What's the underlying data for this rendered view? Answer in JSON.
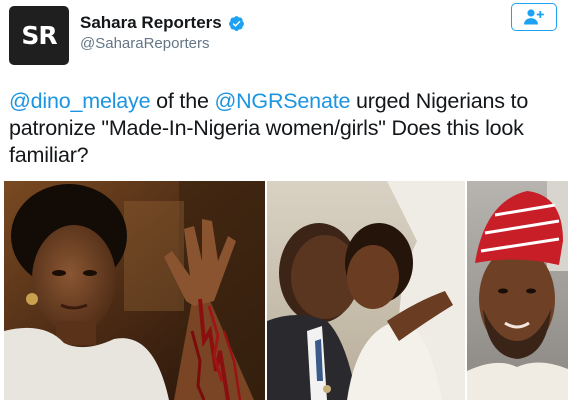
{
  "account": {
    "avatar_text": "SR",
    "display_name": "Sahara Reporters",
    "screen_name": "@SaharaReporters",
    "verified": true
  },
  "follow_button": {
    "icon": "add-user-icon"
  },
  "tweet": {
    "mention_1": "@dino_melaye",
    "text_1": " of the ",
    "mention_2": "@NGRSenate",
    "text_2": " urged Nigerians to patronize \"Made-In-Nigeria women/girls\" Does this look familiar?"
  },
  "colors": {
    "link": "#1b95e0",
    "text": "#14171a",
    "secondary": "#657786",
    "verified": "#1da1f2",
    "avatar_bg": "#1f1f1f"
  }
}
